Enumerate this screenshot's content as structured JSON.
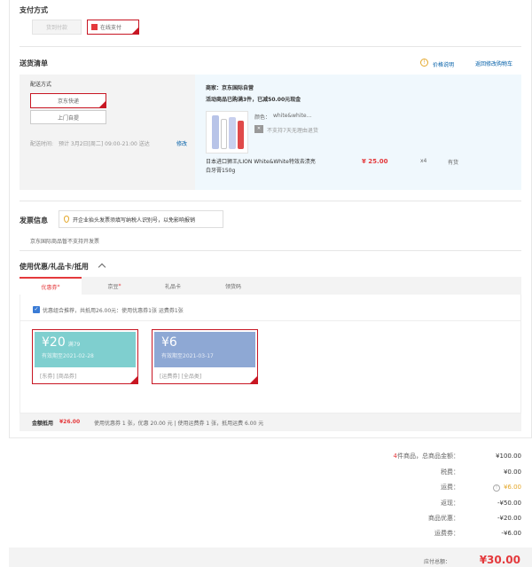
{
  "payment": {
    "title": "支付方式",
    "options": [
      {
        "label": "货到付款",
        "selected": false,
        "disabled": true
      },
      {
        "label": "在线支付",
        "selected": true,
        "disabled": false
      }
    ]
  },
  "delivery": {
    "title": "送货清单",
    "price_note": "价格说明",
    "back_to_cart": "返回修改购物车",
    "method_title": "配送方式",
    "methods": [
      "京东快递",
      "上门自提"
    ],
    "time_label": "配送时间:",
    "time_value": "预计 3月2日[周二] 09:00-21:00 送达",
    "time_edit": "修改",
    "seller": "商家：京东国际自营",
    "promo": "活动商品已购满3件，已减50.00元现金",
    "product": {
      "color_label": "颜色：",
      "color_value": "white&white...",
      "return_note": "不支持7天无理由退货",
      "name_line1": "日本进口狮王/LION White&White特效去渍亮",
      "name_line2": "白牙膏150g",
      "price": "¥ 25.00",
      "qty": "x4",
      "stock": "有货"
    }
  },
  "invoice": {
    "title": "发票信息",
    "tip": "开企业抬头发票须填写纳税人识别号，以免影响报销",
    "note": "京东国际商品暂不支持开发票"
  },
  "discount": {
    "title": "使用优惠/礼品卡/抵用",
    "tabs": [
      "优惠券",
      "京豆",
      "礼品卡",
      "领货码"
    ],
    "recommend": "优惠组合推荐，共抵用26.00元：使用优惠券1张 运费券1张",
    "coupons": [
      {
        "amount": "¥20",
        "cond": "满79",
        "expiry": "有效期至2021-02-28",
        "tags": "[东券]  [商品券]",
        "color": "#7fcfcf"
      },
      {
        "amount": "¥6",
        "cond": "",
        "expiry": "有效期至2021-03-17",
        "tags": "[运费券]  [全品类]",
        "color": "#8ea8d4"
      }
    ],
    "summary_label": "金额抵用",
    "summary_amount": "¥26.00",
    "summary_detail": "使用优惠券 1 张，优惠 20.00 元  |  使用运费券 1 张，抵用运费 6.00 元"
  },
  "totals": {
    "count_prefix": "4",
    "count_label": " 件商品，总商品金额：",
    "goods_total": "¥100.00",
    "rows": [
      {
        "label": "税费：",
        "value": "¥0.00"
      },
      {
        "label": "运费：",
        "value": "¥6.00"
      },
      {
        "label": "返现：",
        "value": "-¥50.00"
      },
      {
        "label": "商品优惠：",
        "value": "-¥20.00"
      },
      {
        "label": "运费券：",
        "value": "-¥6.00"
      }
    ],
    "payable_label": "应付总额：",
    "payable_value": "¥30.00"
  },
  "colors": {
    "accent": "#c81623",
    "link": "#005ea7",
    "highlight_bg": "#f0f8fd"
  }
}
